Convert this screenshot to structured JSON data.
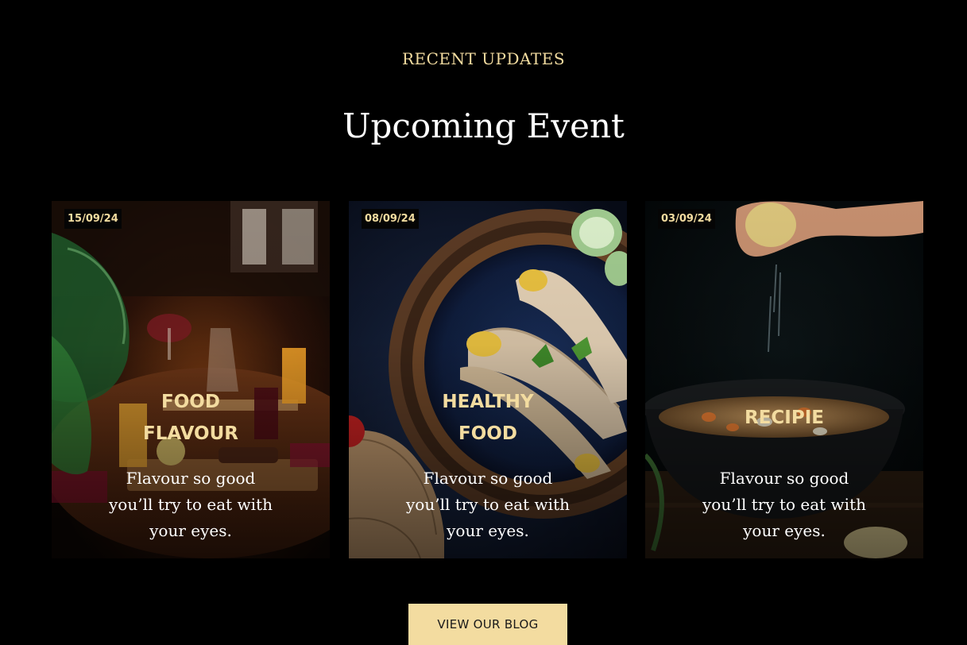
{
  "section": {
    "eyebrow": "RECENT UPDATES",
    "title": "Upcoming Event"
  },
  "cards": [
    {
      "date": "15/09/24",
      "title_line1": "FOOD",
      "title_line2": "FLAVOUR",
      "text": "Flavour so good you’ll try to eat with your eyes.",
      "image": "restaurant-table-photo"
    },
    {
      "date": "08/09/24",
      "title_line1": "HEALTHY",
      "title_line2": "FOOD",
      "text": "Flavour so good you’ll try to eat with your eyes.",
      "image": "wraps-on-plate-photo"
    },
    {
      "date": "03/09/24",
      "title_line1": "RECIPIE",
      "title_line2": "",
      "text": "Flavour so good you’ll try to eat with your eyes.",
      "image": "soup-bowl-photo"
    }
  ],
  "cta": {
    "label": "VIEW OUR BLOG"
  },
  "colors": {
    "background": "#000000",
    "accent": "#f3dca0",
    "text": "#ffffff"
  }
}
